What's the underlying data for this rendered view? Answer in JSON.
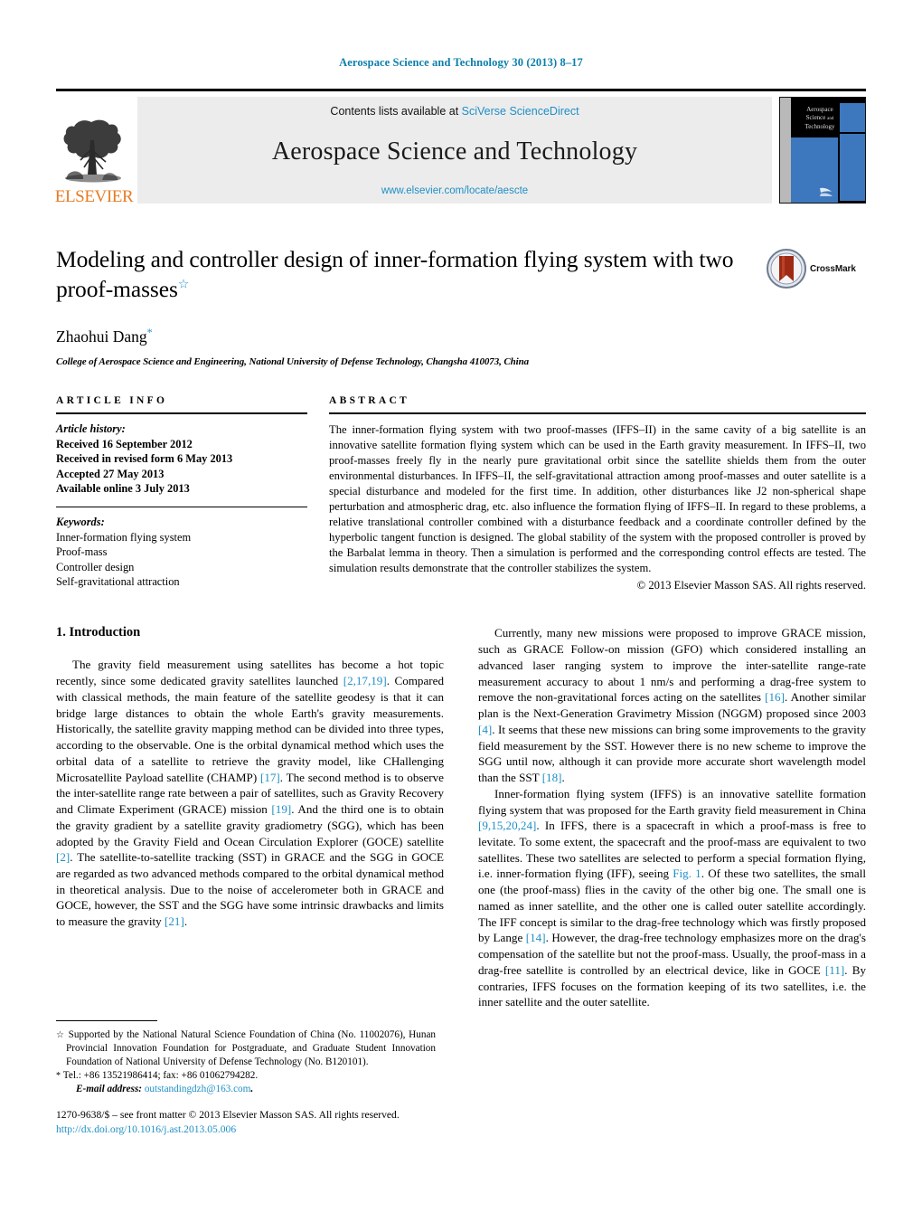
{
  "running_head": "Aerospace Science and Technology 30 (2013) 8–17",
  "masthead": {
    "contents_prefix": "Contents lists available at ",
    "contents_link": "SciVerse ScienceDirect",
    "journal_title": "Aerospace Science and Technology",
    "journal_url": "www.elsevier.com/locate/aescte",
    "publisher_wordmark": "ELSEVIER",
    "cover": {
      "line1": "Aerospace",
      "line2": "Science",
      "line3": "and",
      "line4": "Technology"
    }
  },
  "article": {
    "title": "Modeling and controller design of inner-formation flying system with two proof-masses",
    "title_footnote_mark": "☆",
    "crossmark_label": "CrossMark",
    "author": "Zhaohui Dang",
    "author_mark": "*",
    "affiliation": "College of Aerospace Science and Engineering, National University of Defense Technology, Changsha 410073, China"
  },
  "info": {
    "heading": "ARTICLE INFO",
    "history_label": "Article history:",
    "history": [
      "Received 16 September 2012",
      "Received in revised form 6 May 2013",
      "Accepted 27 May 2013",
      "Available online 3 July 2013"
    ],
    "keywords_label": "Keywords:",
    "keywords": [
      "Inner-formation flying system",
      "Proof-mass",
      "Controller design",
      "Self-gravitational attraction"
    ]
  },
  "abstract": {
    "heading": "ABSTRACT",
    "text": "The inner-formation flying system with two proof-masses (IFFS–II) in the same cavity of a big satellite is an innovative satellite formation flying system which can be used in the Earth gravity measurement. In IFFS–II, two proof-masses freely fly in the nearly pure gravitational orbit since the satellite shields them from the outer environmental disturbances. In IFFS–II, the self-gravitational attraction among proof-masses and outer satellite is a special disturbance and modeled for the first time. In addition, other disturbances like J2 non-spherical shape perturbation and atmospheric drag, etc. also influence the formation flying of IFFS–II. In regard to these problems, a relative translational controller combined with a disturbance feedback and a coordinate controller defined by the hyperbolic tangent function is designed. The global stability of the system with the proposed controller is proved by the Barbalat lemma in theory. Then a simulation is performed and the corresponding control effects are tested. The simulation results demonstrate that the controller stabilizes the system.",
    "copyright": "© 2013 Elsevier Masson SAS. All rights reserved."
  },
  "body": {
    "section_title": "1. Introduction",
    "left_paragraphs": [
      {
        "parts": [
          {
            "t": "The gravity field measurement using satellites has become a hot topic recently, since some dedicated gravity satellites launched "
          },
          {
            "t": "[2,17,19]",
            "ref": true
          },
          {
            "t": ". Compared with classical methods, the main feature of the satellite geodesy is that it can bridge large distances to obtain the whole Earth's gravity measurements. Historically, the satellite gravity mapping method can be divided into three types, according to the observable. One is the orbital dynamical method which uses the orbital data of a satellite to retrieve the gravity model, like CHallenging Microsatellite Payload satellite (CHAMP) "
          },
          {
            "t": "[17]",
            "ref": true
          },
          {
            "t": ". The second method is to observe the inter-satellite range rate between a pair of satellites, such as Gravity Recovery and Climate Experiment (GRACE) mission "
          },
          {
            "t": "[19]",
            "ref": true
          },
          {
            "t": ". And the third one is to obtain the gravity gradient by a satellite gravity gradiometry (SGG), which has been adopted by the Gravity Field and Ocean Circulation Explorer (GOCE) satellite "
          },
          {
            "t": "[2]",
            "ref": true
          },
          {
            "t": ". The satellite-to-satellite tracking (SST) in GRACE and the SGG in GOCE are regarded as two advanced methods compared to the orbital dynamical method in theoretical analysis. Due to the noise of accelerometer both in GRACE and GOCE, however, the SST and the SGG have some intrinsic drawbacks and limits to measure the gravity "
          },
          {
            "t": "[21]",
            "ref": true
          },
          {
            "t": "."
          }
        ]
      }
    ],
    "right_paragraphs": [
      {
        "parts": [
          {
            "t": "Currently, many new missions were proposed to improve GRACE mission, such as GRACE Follow-on mission (GFO) which considered installing an advanced laser ranging system to improve the inter-satellite range-rate measurement accuracy to about 1 nm/s and performing a drag-free system to remove the non-gravitational forces acting on the satellites "
          },
          {
            "t": "[16]",
            "ref": true
          },
          {
            "t": ". Another similar plan is the Next-Generation Gravimetry Mission (NGGM) proposed since 2003 "
          },
          {
            "t": "[4]",
            "ref": true
          },
          {
            "t": ". It seems that these new missions can bring some improvements to the gravity field measurement by the SST. However there is no new scheme to improve the SGG until now, although it can provide more accurate short wavelength model than the SST "
          },
          {
            "t": "[18]",
            "ref": true
          },
          {
            "t": "."
          }
        ]
      },
      {
        "parts": [
          {
            "t": "Inner-formation flying system (IFFS) is an innovative satellite formation flying system that was proposed for the Earth gravity field measurement in China "
          },
          {
            "t": "[9,15,20,24]",
            "ref": true
          },
          {
            "t": ". In IFFS, there is a spacecraft in which a proof-mass is free to levitate. To some extent, the spacecraft and the proof-mass are equivalent to two satellites. These two satellites are selected to perform a special formation flying, i.e. inner-formation flying (IFF), seeing "
          },
          {
            "t": "Fig. 1",
            "ref": true
          },
          {
            "t": ". Of these two satellites, the small one (the proof-mass) flies in the cavity of the other big one. The small one is named as inner satellite, and the other one is called outer satellite accordingly. The IFF concept is similar to the drag-free technology which was firstly proposed by Lange "
          },
          {
            "t": "[14]",
            "ref": true
          },
          {
            "t": ". However, the drag-free technology emphasizes more on the drag's compensation of the satellite but not the proof-mass. Usually, the proof-mass in a drag-free satellite is controlled by an electrical device, like in GOCE "
          },
          {
            "t": "[11]",
            "ref": true
          },
          {
            "t": ". By contraries, IFFS focuses on the formation keeping of its two satellites, i.e. the inner satellite and the outer satellite."
          }
        ]
      }
    ]
  },
  "footnotes": {
    "funding_mark": "☆",
    "funding": "Supported by the National Natural Science Foundation of China (No. 11002076), Hunan Provincial Innovation Foundation for Postgraduate, and Graduate Student Innovation Foundation of National University of Defense Technology (No. B120101).",
    "contact_mark": "*",
    "contact": "Tel.: +86 13521986414; fax: +86 01062794282.",
    "email_label": "E-mail address:",
    "email": "outstandingdzh@163.com",
    "email_suffix": ".",
    "issn_line": "1270-9638/$ – see front matter © 2013 Elsevier Masson SAS. All rights reserved.",
    "doi": "http://dx.doi.org/10.1016/j.ast.2013.05.006"
  },
  "colors": {
    "link": "#1f8fc6",
    "running_head": "#0b7fab",
    "elsevier_orange": "#E87B22",
    "cover_blue": "#3d77bd",
    "crossmark_red": "#9e2a16"
  }
}
